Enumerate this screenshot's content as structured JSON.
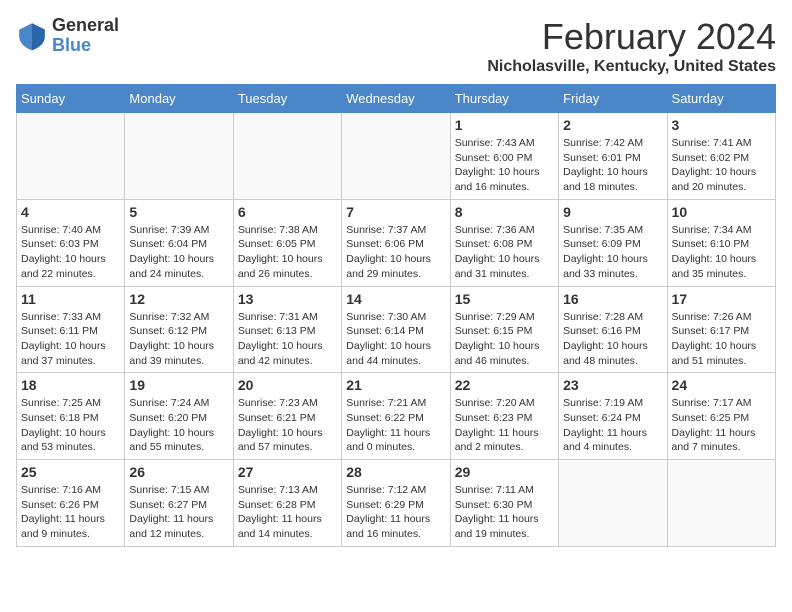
{
  "logo": {
    "general": "General",
    "blue": "Blue"
  },
  "title": "February 2024",
  "subtitle": "Nicholasville, Kentucky, United States",
  "weekdays": [
    "Sunday",
    "Monday",
    "Tuesday",
    "Wednesday",
    "Thursday",
    "Friday",
    "Saturday"
  ],
  "weeks": [
    [
      {
        "day": "",
        "info": ""
      },
      {
        "day": "",
        "info": ""
      },
      {
        "day": "",
        "info": ""
      },
      {
        "day": "",
        "info": ""
      },
      {
        "day": "1",
        "info": "Sunrise: 7:43 AM\nSunset: 6:00 PM\nDaylight: 10 hours\nand 16 minutes."
      },
      {
        "day": "2",
        "info": "Sunrise: 7:42 AM\nSunset: 6:01 PM\nDaylight: 10 hours\nand 18 minutes."
      },
      {
        "day": "3",
        "info": "Sunrise: 7:41 AM\nSunset: 6:02 PM\nDaylight: 10 hours\nand 20 minutes."
      }
    ],
    [
      {
        "day": "4",
        "info": "Sunrise: 7:40 AM\nSunset: 6:03 PM\nDaylight: 10 hours\nand 22 minutes."
      },
      {
        "day": "5",
        "info": "Sunrise: 7:39 AM\nSunset: 6:04 PM\nDaylight: 10 hours\nand 24 minutes."
      },
      {
        "day": "6",
        "info": "Sunrise: 7:38 AM\nSunset: 6:05 PM\nDaylight: 10 hours\nand 26 minutes."
      },
      {
        "day": "7",
        "info": "Sunrise: 7:37 AM\nSunset: 6:06 PM\nDaylight: 10 hours\nand 29 minutes."
      },
      {
        "day": "8",
        "info": "Sunrise: 7:36 AM\nSunset: 6:08 PM\nDaylight: 10 hours\nand 31 minutes."
      },
      {
        "day": "9",
        "info": "Sunrise: 7:35 AM\nSunset: 6:09 PM\nDaylight: 10 hours\nand 33 minutes."
      },
      {
        "day": "10",
        "info": "Sunrise: 7:34 AM\nSunset: 6:10 PM\nDaylight: 10 hours\nand 35 minutes."
      }
    ],
    [
      {
        "day": "11",
        "info": "Sunrise: 7:33 AM\nSunset: 6:11 PM\nDaylight: 10 hours\nand 37 minutes."
      },
      {
        "day": "12",
        "info": "Sunrise: 7:32 AM\nSunset: 6:12 PM\nDaylight: 10 hours\nand 39 minutes."
      },
      {
        "day": "13",
        "info": "Sunrise: 7:31 AM\nSunset: 6:13 PM\nDaylight: 10 hours\nand 42 minutes."
      },
      {
        "day": "14",
        "info": "Sunrise: 7:30 AM\nSunset: 6:14 PM\nDaylight: 10 hours\nand 44 minutes."
      },
      {
        "day": "15",
        "info": "Sunrise: 7:29 AM\nSunset: 6:15 PM\nDaylight: 10 hours\nand 46 minutes."
      },
      {
        "day": "16",
        "info": "Sunrise: 7:28 AM\nSunset: 6:16 PM\nDaylight: 10 hours\nand 48 minutes."
      },
      {
        "day": "17",
        "info": "Sunrise: 7:26 AM\nSunset: 6:17 PM\nDaylight: 10 hours\nand 51 minutes."
      }
    ],
    [
      {
        "day": "18",
        "info": "Sunrise: 7:25 AM\nSunset: 6:18 PM\nDaylight: 10 hours\nand 53 minutes."
      },
      {
        "day": "19",
        "info": "Sunrise: 7:24 AM\nSunset: 6:20 PM\nDaylight: 10 hours\nand 55 minutes."
      },
      {
        "day": "20",
        "info": "Sunrise: 7:23 AM\nSunset: 6:21 PM\nDaylight: 10 hours\nand 57 minutes."
      },
      {
        "day": "21",
        "info": "Sunrise: 7:21 AM\nSunset: 6:22 PM\nDaylight: 11 hours\nand 0 minutes."
      },
      {
        "day": "22",
        "info": "Sunrise: 7:20 AM\nSunset: 6:23 PM\nDaylight: 11 hours\nand 2 minutes."
      },
      {
        "day": "23",
        "info": "Sunrise: 7:19 AM\nSunset: 6:24 PM\nDaylight: 11 hours\nand 4 minutes."
      },
      {
        "day": "24",
        "info": "Sunrise: 7:17 AM\nSunset: 6:25 PM\nDaylight: 11 hours\nand 7 minutes."
      }
    ],
    [
      {
        "day": "25",
        "info": "Sunrise: 7:16 AM\nSunset: 6:26 PM\nDaylight: 11 hours\nand 9 minutes."
      },
      {
        "day": "26",
        "info": "Sunrise: 7:15 AM\nSunset: 6:27 PM\nDaylight: 11 hours\nand 12 minutes."
      },
      {
        "day": "27",
        "info": "Sunrise: 7:13 AM\nSunset: 6:28 PM\nDaylight: 11 hours\nand 14 minutes."
      },
      {
        "day": "28",
        "info": "Sunrise: 7:12 AM\nSunset: 6:29 PM\nDaylight: 11 hours\nand 16 minutes."
      },
      {
        "day": "29",
        "info": "Sunrise: 7:11 AM\nSunset: 6:30 PM\nDaylight: 11 hours\nand 19 minutes."
      },
      {
        "day": "",
        "info": ""
      },
      {
        "day": "",
        "info": ""
      }
    ]
  ]
}
